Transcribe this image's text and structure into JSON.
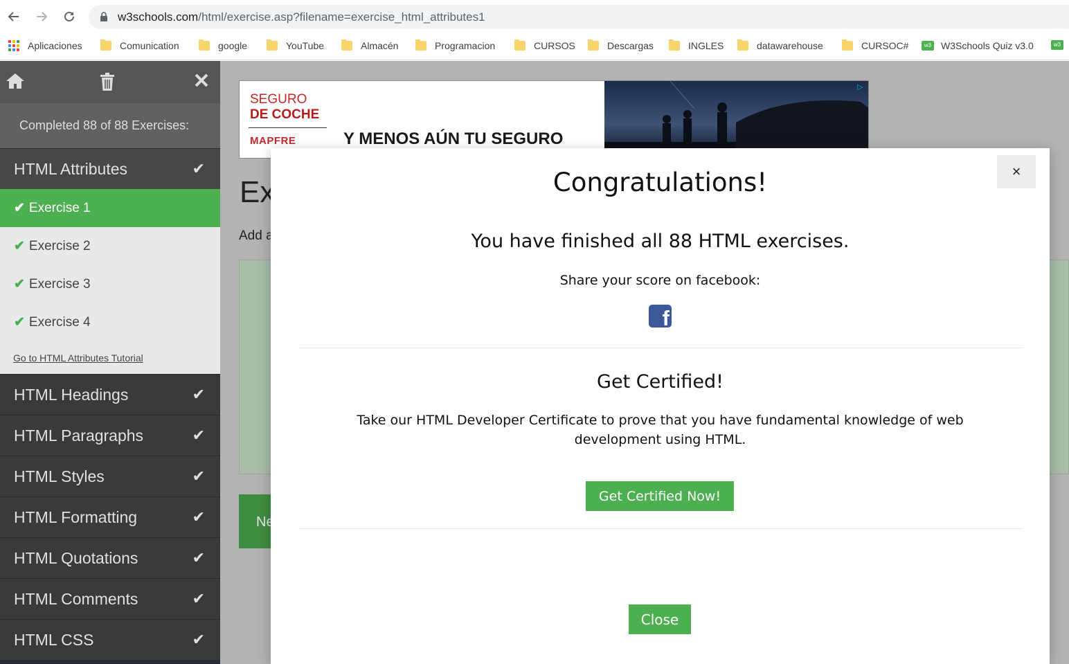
{
  "browser": {
    "url_host": "w3schools.com",
    "url_path": "/html/exercise.asp?filename=exercise_html_attributes1",
    "bookmarks": [
      {
        "label": "Aplicaciones",
        "icon": "apps-grid-icon"
      },
      {
        "label": "Comunication",
        "icon": "folder-icon"
      },
      {
        "label": "google",
        "icon": "folder-icon"
      },
      {
        "label": "YouTube",
        "icon": "folder-icon"
      },
      {
        "label": "Almacén",
        "icon": "folder-icon"
      },
      {
        "label": "Programacion",
        "icon": "folder-icon"
      },
      {
        "label": "CURSOS",
        "icon": "folder-icon"
      },
      {
        "label": "Descargas",
        "icon": "folder-icon"
      },
      {
        "label": "INGLES",
        "icon": "folder-icon"
      },
      {
        "label": "datawarehouse",
        "icon": "folder-icon"
      },
      {
        "label": "CURSOC#",
        "icon": "folder-icon"
      },
      {
        "label": "W3Schools Quiz v3.0",
        "icon": "w3schools-icon"
      }
    ]
  },
  "sidebar": {
    "completed": "Completed 88 of 88 Exercises:",
    "active_section": "HTML Attributes",
    "exercises": [
      "Exercise 1",
      "Exercise 2",
      "Exercise 3",
      "Exercise 4"
    ],
    "tutorial_link": "Go to HTML Attributes Tutorial",
    "sections": [
      "HTML Headings",
      "HTML Paragraphs",
      "HTML Styles",
      "HTML Formatting",
      "HTML Quotations",
      "HTML Comments",
      "HTML CSS"
    ]
  },
  "ad": {
    "line1": "SEGURO",
    "line2": "DE COCHE",
    "brand": "MAPFRE",
    "slogan": "Y MENOS AÚN TU SEGURO"
  },
  "main": {
    "title_partial": "Ex",
    "text_partial": "Add a",
    "next_partial": "Ne"
  },
  "modal": {
    "close_x": "×",
    "title": "Congratulations!",
    "finished": "You have finished all 88 HTML exercises.",
    "share": "Share your score on facebook:",
    "cert_title": "Get Certified!",
    "cert_desc": "Take our HTML Developer Certificate to prove that you have fundamental knowledge of web development using HTML.",
    "cert_button": "Get Certified Now!",
    "close_button": "Close"
  },
  "colors": {
    "w3_green": "#4caf50",
    "sidebar_dark": "#282a35",
    "facebook_blue": "#3b5998"
  }
}
